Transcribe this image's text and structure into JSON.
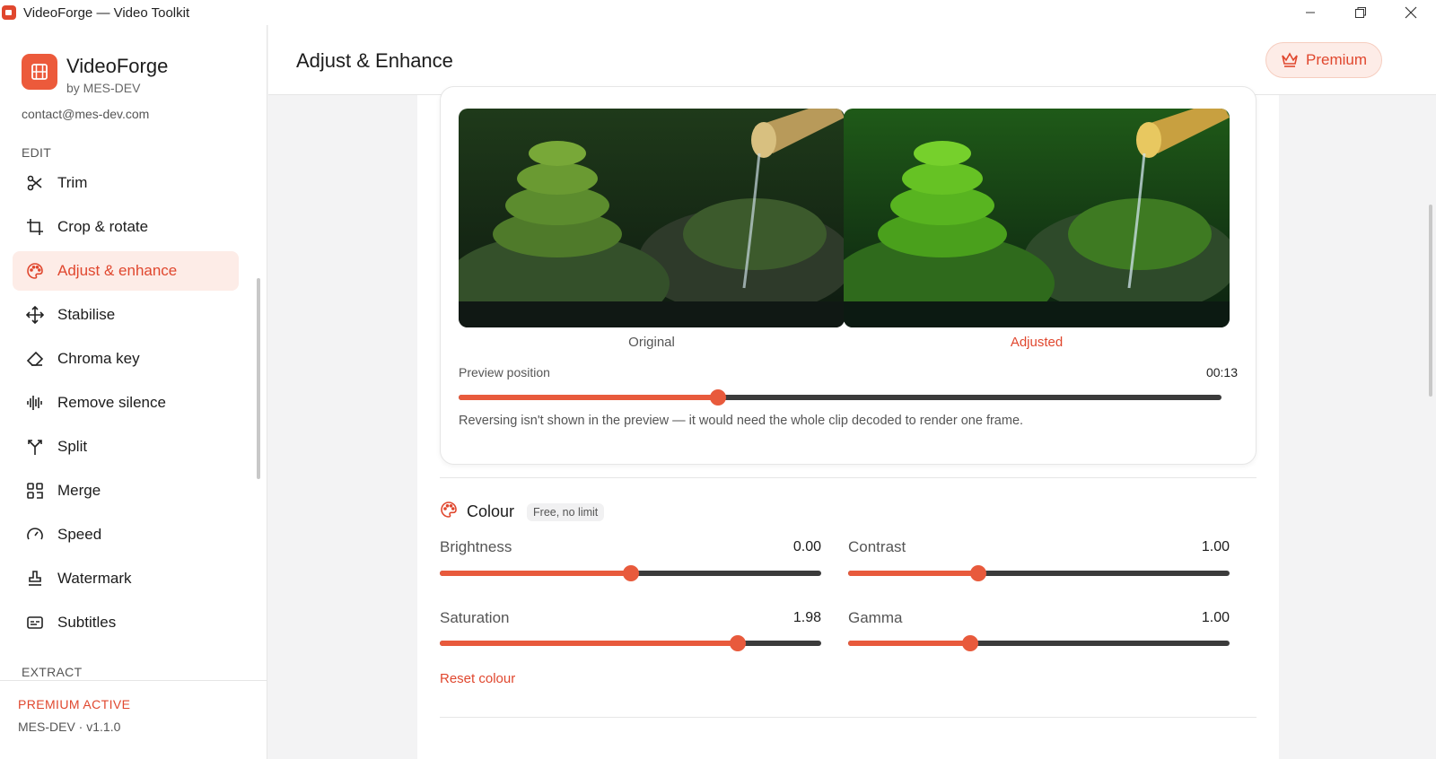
{
  "window": {
    "title": "VideoForge — Video Toolkit"
  },
  "sidebar": {
    "brand_name": "VideoForge",
    "brand_by": "by MES-DEV",
    "contact": "contact@mes-dev.com",
    "section_edit": "EDIT",
    "section_extract": "EXTRACT",
    "items": [
      {
        "label": "Trim",
        "icon": "scissors-icon"
      },
      {
        "label": "Crop & rotate",
        "icon": "crop-icon"
      },
      {
        "label": "Adjust & enhance",
        "icon": "palette-icon",
        "active": true
      },
      {
        "label": "Stabilise",
        "icon": "move-icon"
      },
      {
        "label": "Chroma key",
        "icon": "eraser-icon"
      },
      {
        "label": "Remove silence",
        "icon": "audio-wave-icon"
      },
      {
        "label": "Split",
        "icon": "split-icon"
      },
      {
        "label": "Merge",
        "icon": "merge-icon"
      },
      {
        "label": "Speed",
        "icon": "gauge-icon"
      },
      {
        "label": "Watermark",
        "icon": "stamp-icon"
      },
      {
        "label": "Subtitles",
        "icon": "captions-icon"
      }
    ],
    "footer_status": "PREMIUM ACTIVE",
    "footer_version": "MES-DEV · v1.1.0"
  },
  "header": {
    "title": "Adjust & Enhance",
    "premium_label": "Premium"
  },
  "preview": {
    "original_label": "Original",
    "adjusted_label": "Adjusted",
    "position_label": "Preview position",
    "position_time": "00:13",
    "position_fraction": 0.34,
    "note": "Reversing isn't shown in the preview — it would need the whole clip decoded to render one frame."
  },
  "colour": {
    "title": "Colour",
    "badge": "Free, no limit",
    "controls": [
      {
        "label": "Brightness",
        "value": "0.00",
        "fraction": 0.5
      },
      {
        "label": "Contrast",
        "value": "1.00",
        "fraction": 0.34
      },
      {
        "label": "Saturation",
        "value": "1.98",
        "fraction": 0.78
      },
      {
        "label": "Gamma",
        "value": "1.00",
        "fraction": 0.32
      }
    ],
    "reset_label": "Reset colour"
  },
  "colors": {
    "accent": "#e85a3c",
    "accent_soft": "#fdece7",
    "track": "#3b3b3b"
  }
}
